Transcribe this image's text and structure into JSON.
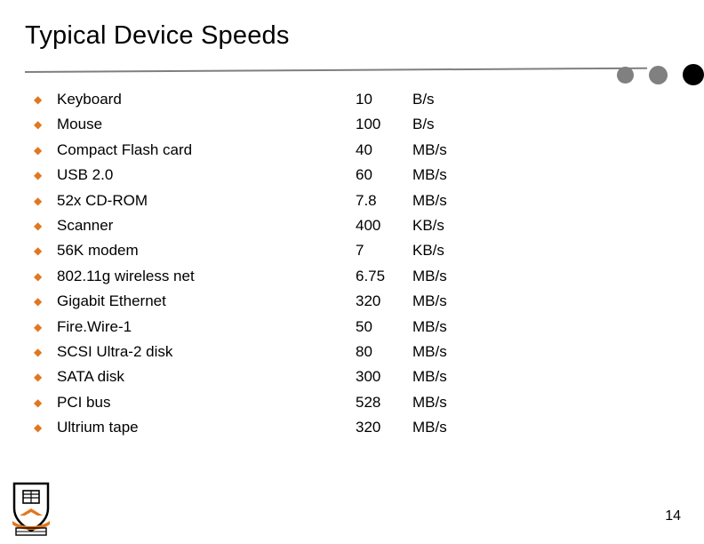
{
  "slide": {
    "title": "Typical Device Speeds",
    "page_number": "14",
    "bullet_glyph": "◆",
    "accent_color": "#E1771E",
    "rule_color": "#7F7F7F",
    "dot_colors": [
      "#808080",
      "#808080",
      "#000000"
    ],
    "rows": [
      {
        "name": "Keyboard",
        "value": "10",
        "unit": "B/s"
      },
      {
        "name": "Mouse",
        "value": "100",
        "unit": "B/s"
      },
      {
        "name": "Compact Flash card",
        "value": "40",
        "unit": "MB/s"
      },
      {
        "name": "USB 2.0",
        "value": "60",
        "unit": "MB/s"
      },
      {
        "name": "52x CD-ROM",
        "value": "7.8",
        "unit": "MB/s"
      },
      {
        "name": "Scanner",
        "value": "400",
        "unit": "KB/s"
      },
      {
        "name": "56K modem",
        "value": "7",
        "unit": "KB/s"
      },
      {
        "name": "802.11g wireless net",
        "value": "6.75",
        "unit": "MB/s"
      },
      {
        "name": "Gigabit Ethernet",
        "value": "320",
        "unit": "MB/s"
      },
      {
        "name": "Fire.Wire-1",
        "value": "50",
        "unit": "MB/s"
      },
      {
        "name": "SCSI Ultra-2 disk",
        "value": "80",
        "unit": "MB/s"
      },
      {
        "name": "SATA disk",
        "value": "300",
        "unit": "MB/s"
      },
      {
        "name": "PCI bus",
        "value": "528",
        "unit": "MB/s"
      },
      {
        "name": "Ultrium tape",
        "value": "320",
        "unit": "MB/s"
      }
    ]
  }
}
